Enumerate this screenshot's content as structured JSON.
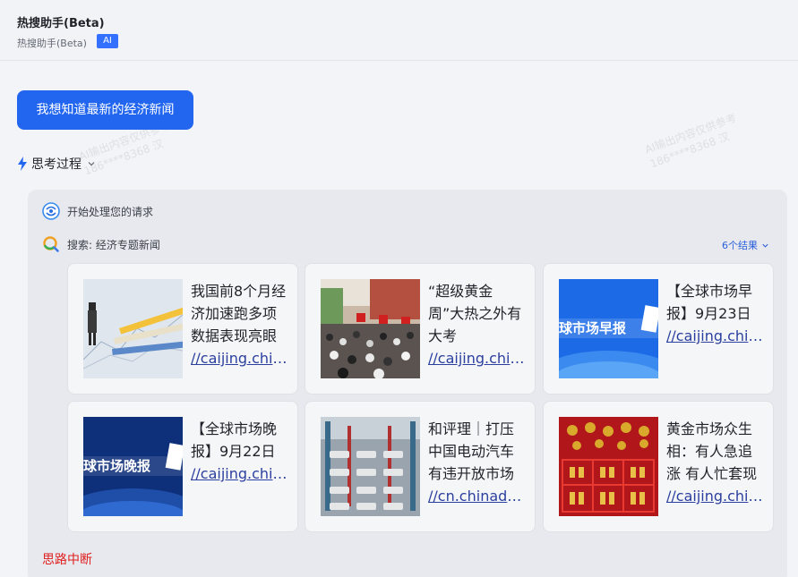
{
  "header": {
    "title": "热搜助手(Beta)",
    "subtitle": "热搜助手(Beta)",
    "badge": "AI"
  },
  "query": {
    "text": "我想知道最新的经济新闻"
  },
  "thinking": {
    "label": "思考过程"
  },
  "steps": [
    {
      "label": "开始处理您的请求"
    },
    {
      "label": "搜索: 经济专题新闻"
    }
  ],
  "results_toggle": {
    "label": "6个结果"
  },
  "cards": [
    {
      "title": "我国前8个月经济加速跑多项数据表现亮眼",
      "link": "//caijing.chinadaily.com.cn"
    },
    {
      "title": "“超级黄金周”大热之外有大考",
      "link": "//caijing.chinadaily.com.cn"
    },
    {
      "title": "【全球市场早报】9月23日",
      "link": "//caijing.chinadaily.com.cn"
    },
    {
      "title": "【全球市场晚报】9月22日",
      "link": "//caijing.chinadaily.com.cn"
    },
    {
      "title": "和评理｜打压中国电动汽车有违开放市场原则",
      "link": "//cn.chinadaily.com.cn"
    },
    {
      "title": "黄金市场众生相：有人急追涨 有人忙套现",
      "link": "//caijing.chinadaily.com.cn"
    }
  ],
  "thumb_texts": {
    "morning": "球市场早报",
    "evening": "球市场晚报"
  },
  "status": {
    "interrupted": "思路中断"
  },
  "watermark": {
    "line1": "AI输出内容仅供参考",
    "line2": "186****8368 汉"
  },
  "colors": {
    "accent": "#2266f0",
    "link": "#2b3f9e",
    "error": "#e02020",
    "panel": "#e7e9ee"
  }
}
